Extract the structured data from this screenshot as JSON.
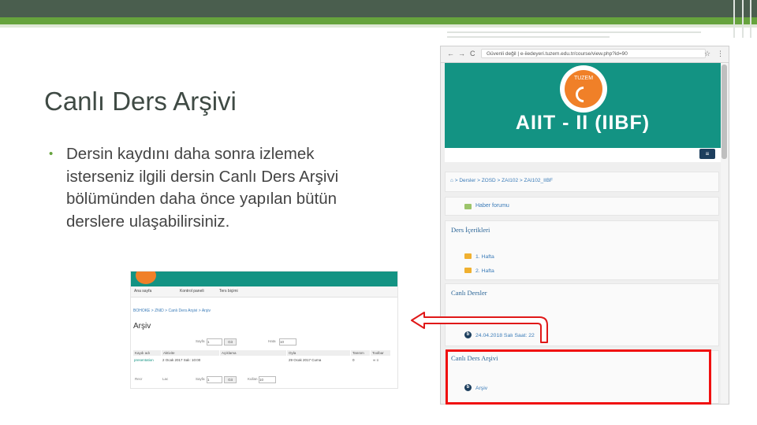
{
  "slide": {
    "title": "Canlı Ders Arşivi",
    "bullet_symbol": "•",
    "bullet": "Dersin kaydını daha sonra izlemek isterseniz ilgili dersin Canlı Ders Arşivi bölümünden daha önce yapılan bütün derslere ulaşabilirsiniz."
  },
  "small_screenshot": {
    "nav": [
      "Ana sayfa",
      "Kontrol paneli",
      "Ters biçimi"
    ],
    "breadcrumb": "BOHOKE > ZNID > Canlı Ders Arşivi > Arşiv",
    "heading": "Arşiv",
    "controls": [
      "Sayfa",
      "Bo",
      "Hata"
    ],
    "go": "Git",
    "page_value": "1",
    "count_value": "10",
    "table_headers": [
      "Kaydı adı",
      "Aktivite",
      "Açıklama",
      "Oyla",
      "Tanıtım",
      "Toolbar"
    ],
    "row": {
      "name": "presentation",
      "activity": "2 Ocak 2017 Salı: 10:00",
      "date": "29 Ocak 2017 Cuma",
      "duration": "0",
      "actions": "∞ ≡"
    },
    "bottom_controls": [
      "Recr",
      "Lac",
      "Sayfa",
      "Kullan"
    ]
  },
  "browser": {
    "nav_back": "←",
    "nav_forward": "→",
    "reload": "C",
    "url": "Güvenli değil | e-iiedeyeri.tuzem.edu.tr/course/view.php?id=90",
    "star": "☆",
    "menu": "⋮",
    "logo_text": "TUZEM",
    "course_title": "AIIT - II (IIBF)",
    "hamburger": "≡",
    "breadcrumb": "⌂ > Dersler > ZOSD > ZAI102 > ZAI102_IIBF",
    "news_forum": "Haber forumu",
    "section_contents": "Ders İçerikleri",
    "contents_items": [
      "1. Hafta",
      "2. Hafta"
    ],
    "section_live": "Canlı Dersler",
    "live_session": "24.04.2018 Salı Saat: 22",
    "section_archive": "Canlı Ders Arşivi",
    "archive_item": "Arşiv"
  },
  "colors": {
    "teal": "#139383",
    "orange": "#f08028",
    "highlight_red": "#f01010",
    "slide_green": "#66a33d"
  }
}
